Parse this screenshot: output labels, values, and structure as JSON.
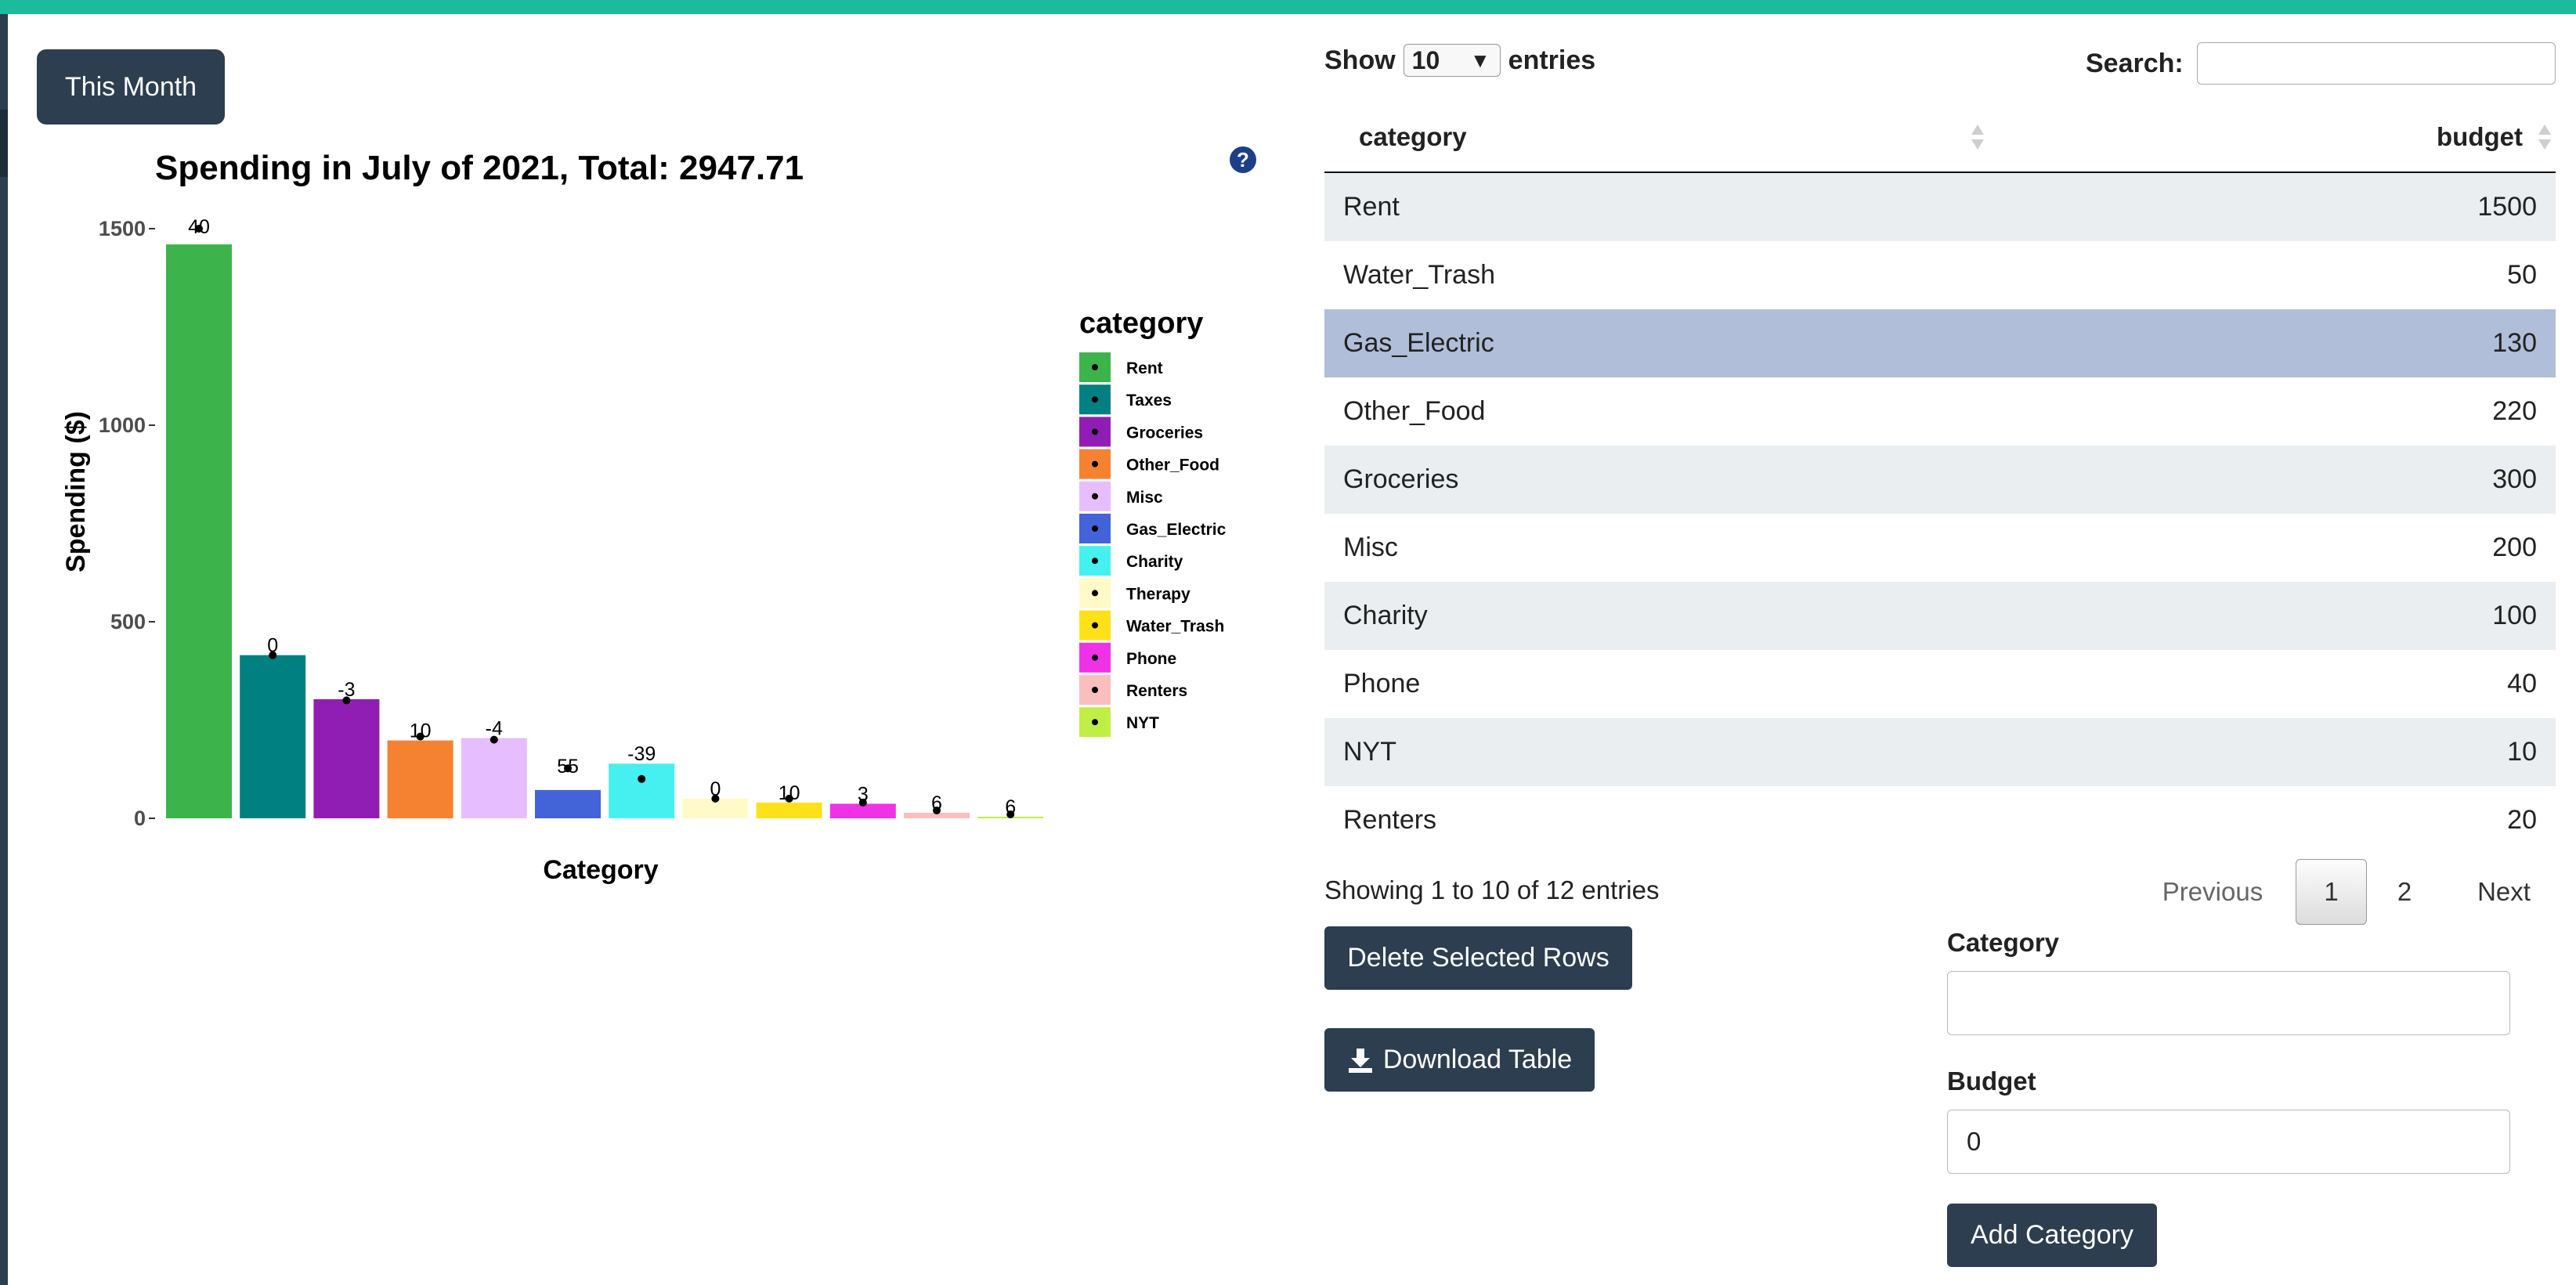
{
  "app": {
    "accent_color": "#1abc9c",
    "dark_color": "#2c3e50"
  },
  "controls": {
    "this_month_label": "This Month",
    "delete_label": "Delete Selected Rows",
    "download_label": "Download Table",
    "download_icon": "download-icon",
    "add_category_label": "Add Category",
    "help_icon": "question-circle-icon"
  },
  "chart_data": {
    "type": "bar",
    "title": "Spending in July of 2021, Total: 2947.71",
    "xlabel": "Category",
    "ylabel": "Spending ($)",
    "ylim": [
      0,
      1500
    ],
    "yticks": [
      0,
      500,
      1000,
      1500
    ],
    "legend_title": "category",
    "legend_position": "right",
    "grid": false,
    "categories": [
      "Rent",
      "Taxes",
      "Groceries",
      "Other_Food",
      "Misc",
      "Gas_Electric",
      "Charity",
      "Therapy",
      "Water_Trash",
      "Phone",
      "Renters",
      "NYT"
    ],
    "colors": [
      "#3cb44b",
      "#008080",
      "#911eb4",
      "#f58231",
      "#e6beff",
      "#4363d8",
      "#46f0f0",
      "#fffac8",
      "#ffe119",
      "#f032e6",
      "#fabebe",
      "#bfef45"
    ],
    "values": [
      1460,
      415,
      303,
      198,
      204,
      72,
      139,
      50,
      40,
      37,
      14,
      4
    ],
    "budget_points": [
      1500,
      415,
      300,
      208,
      200,
      127,
      100,
      50,
      50,
      40,
      20,
      10
    ],
    "data_labels": [
      "40",
      "0",
      "-3",
      "10",
      "-4",
      "55",
      "-39",
      "0",
      "10",
      "3",
      "6",
      "6"
    ]
  },
  "table": {
    "show_label": "Show",
    "entries_label": "entries",
    "page_size": "10",
    "search_label": "Search:",
    "search_value": "",
    "columns": [
      "category",
      "budget"
    ],
    "rows": [
      {
        "category": "Rent",
        "budget": "1500"
      },
      {
        "category": "Water_Trash",
        "budget": "50"
      },
      {
        "category": "Gas_Electric",
        "budget": "130"
      },
      {
        "category": "Other_Food",
        "budget": "220"
      },
      {
        "category": "Groceries",
        "budget": "300"
      },
      {
        "category": "Misc",
        "budget": "200"
      },
      {
        "category": "Charity",
        "budget": "100"
      },
      {
        "category": "Phone",
        "budget": "40"
      },
      {
        "category": "NYT",
        "budget": "10"
      },
      {
        "category": "Renters",
        "budget": "20"
      }
    ],
    "selected_row_index": 2,
    "info": "Showing 1 to 10 of 12 entries",
    "pagination": {
      "previous": "Previous",
      "pages": [
        "1",
        "2"
      ],
      "current": "1",
      "next": "Next"
    }
  },
  "form": {
    "category_label": "Category",
    "category_value": "",
    "budget_label": "Budget",
    "budget_value": "0"
  }
}
